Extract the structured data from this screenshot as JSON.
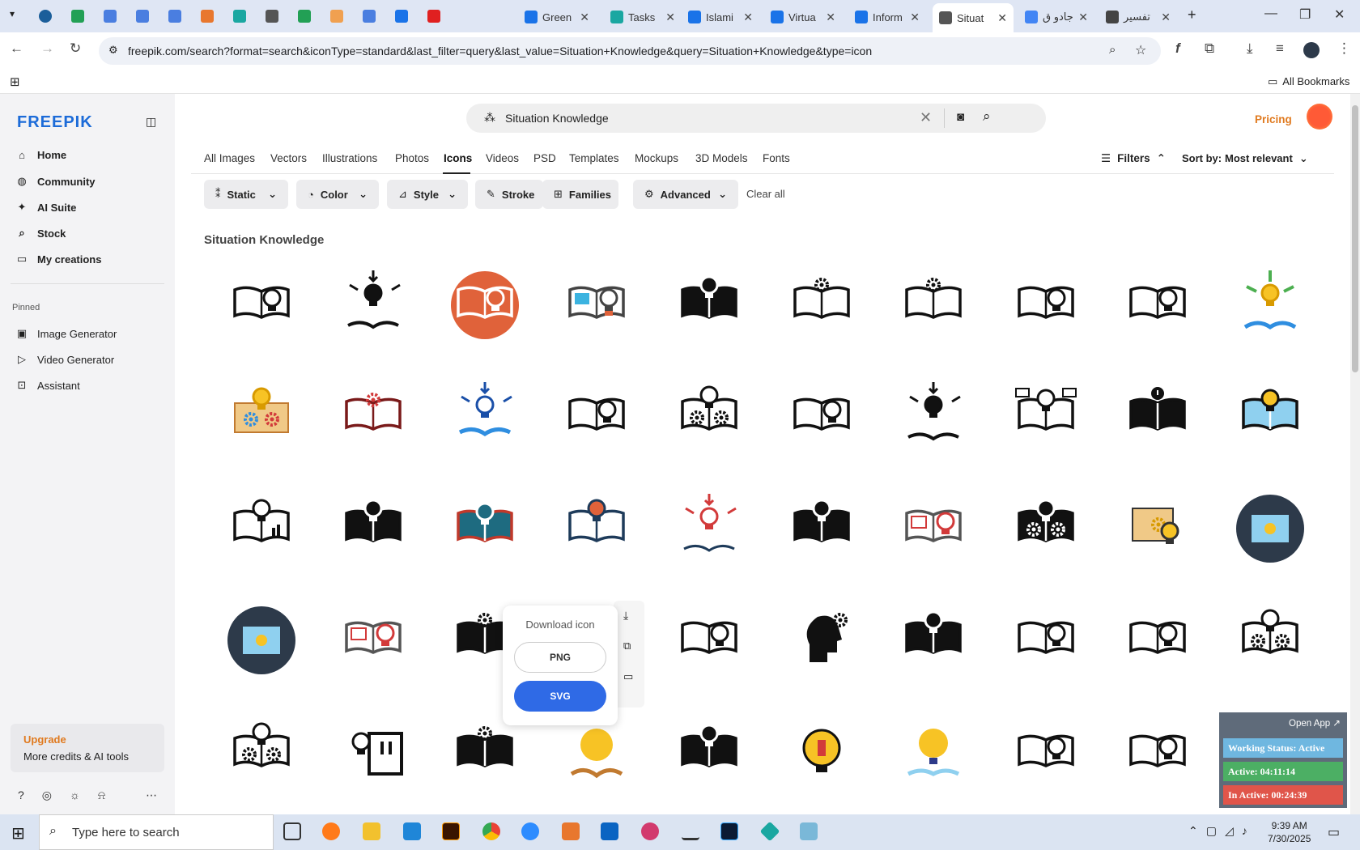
{
  "browser": {
    "tabs": [
      {
        "title": "Green",
        "fav": "#1a73e8"
      },
      {
        "title": "Tasks",
        "fav": "#1aa7a1"
      },
      {
        "title": "Islami",
        "fav": "#1a73e8"
      },
      {
        "title": "Virtua",
        "fav": "#1a73e8"
      },
      {
        "title": "Inform",
        "fav": "#1a73e8"
      },
      {
        "title": "Situat",
        "fav": "#555555"
      },
      {
        "title": "جادو ق",
        "fav": "#4285f4"
      },
      {
        "title": "تفسير",
        "fav": "#444444"
      }
    ],
    "url": "freepik.com/search?format=search&iconType=standard&last_filter=query&last_value=Situation+Knowledge&query=Situation+Knowledge&type=icon",
    "bookmarks_label": "All Bookmarks"
  },
  "sidebar": {
    "logo": "FREEPIK",
    "nav": [
      {
        "label": "Home",
        "icon": "home-icon",
        "glyph": "⌂"
      },
      {
        "label": "Community",
        "icon": "globe-icon",
        "glyph": "◍"
      },
      {
        "label": "AI Suite",
        "icon": "sparkle-icon",
        "glyph": "✦"
      },
      {
        "label": "Stock",
        "icon": "search-icon",
        "glyph": "⌕"
      },
      {
        "label": "My creations",
        "icon": "folder-icon",
        "glyph": "▭"
      }
    ],
    "pinned_label": "Pinned",
    "pinned": [
      {
        "label": "Image Generator",
        "icon": "image-icon",
        "glyph": "▣"
      },
      {
        "label": "Video Generator",
        "icon": "video-icon",
        "glyph": "▷"
      },
      {
        "label": "Assistant",
        "icon": "chat-icon",
        "glyph": "⊡"
      }
    ],
    "upgrade": {
      "title": "Upgrade",
      "subtitle": "More credits & AI tools"
    }
  },
  "header": {
    "search_value": "Situation Knowledge",
    "pricing": "Pricing"
  },
  "categories": [
    "All Images",
    "Vectors",
    "Illustrations",
    "Photos",
    "Icons",
    "Videos",
    "PSD",
    "Templates",
    "Mockups",
    "3D Models",
    "Fonts"
  ],
  "active_category": "Icons",
  "filters_label": "Filters",
  "sort_label": "Sort by:",
  "sort_value": "Most relevant",
  "chips": [
    "Static",
    "Color",
    "Style",
    "Stroke",
    "Families",
    "Advanced"
  ],
  "clear_all": "Clear all",
  "results_title": "Situation Knowledge",
  "popup": {
    "title": "Download icon",
    "png": "PNG",
    "svg": "SVG"
  },
  "taskbar": {
    "search_placeholder": "Type here to search",
    "time": "9:39 AM",
    "date": "7/30/2025"
  },
  "widget": {
    "open_app": "Open App ↗",
    "status": "Working Status: Active",
    "active": "Active: 04:11:14",
    "inactive": "In Active: 00:24:39"
  },
  "grid": [
    [
      "book-bulb-outline",
      "bulb-arrows-book",
      "orange-circle-book",
      "book-bulb-blue",
      "book-bulb-solid",
      "book-gear-outline",
      "book-gear-outline",
      "book-bulb-outline",
      "book-bulb-outline",
      "bulb-arrows-color"
    ],
    [
      "book-gears-color",
      "book-gear-red",
      "bulb-arrows-blue",
      "book-bulb-outline",
      "book-gears-outline",
      "book-bulb-outline",
      "bulb-arrows-book",
      "book-bulb-chat",
      "book-exclaim-solid",
      "book-bulb-blue-fill"
    ],
    [
      "book-chart-bulb",
      "book-bulb-solid",
      "book-bulb-teal",
      "book-bulb-orange",
      "bulb-arrows-red",
      "book-bulb-solid",
      "book-bulb-red",
      "book-gears-solid",
      "bulb-gear-color",
      "dark-circle-book"
    ],
    [
      "dark-circle-book",
      "book-bulb-red",
      "book-gear-solid",
      "book-bulb-outline",
      "book-bulb-outline",
      "head-gear-solid",
      "book-bulb-solid",
      "book-bulb-outline",
      "book-bulb-outline",
      "book-gears-outline"
    ],
    [
      "book-gears-outline",
      "bulb-book-solid",
      "book-gear-solid",
      "bulb-color-book",
      "book-bulb-solid",
      "bulb-yellow",
      "bulb-yellow-blue",
      "book-bulb-outline",
      "book-bulb-outline",
      "book-gear-solid"
    ]
  ]
}
